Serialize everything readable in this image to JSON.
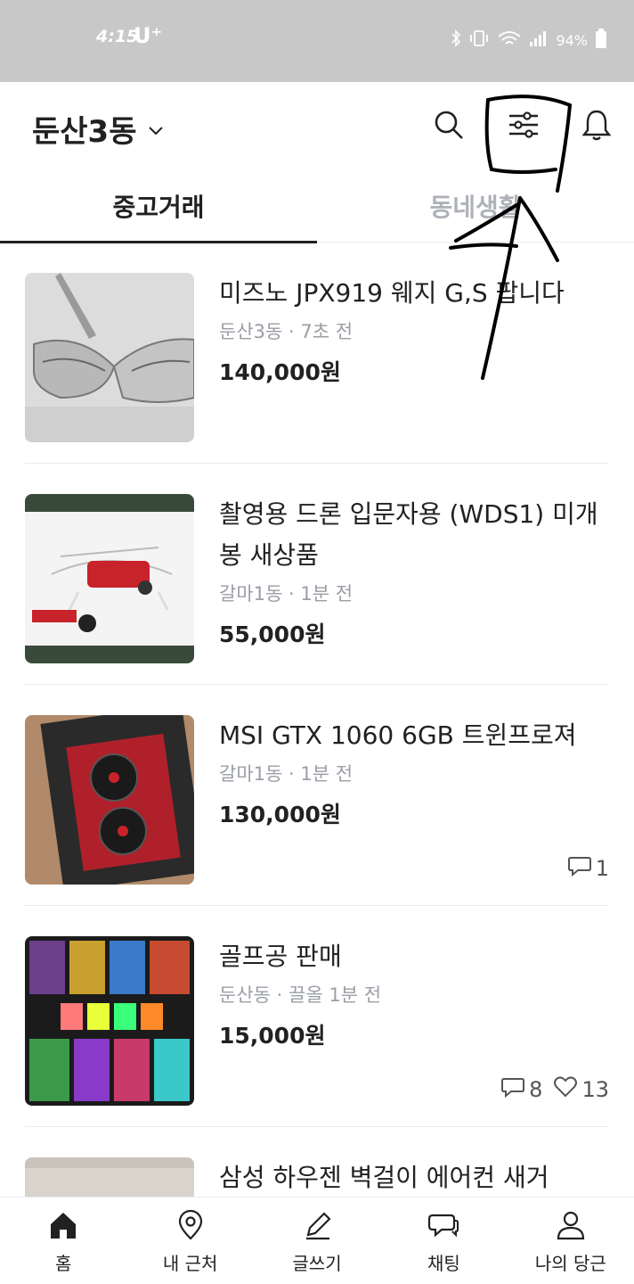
{
  "status_bar": {
    "time": "4:15",
    "carrier": "U⁺",
    "battery": "94%",
    "icons": [
      "bluetooth-icon",
      "vibrate-icon",
      "wifi-icon",
      "signal-icon",
      "battery-icon"
    ]
  },
  "header": {
    "location": "둔산3동",
    "icons": [
      "search-icon",
      "filter-icon",
      "bell-icon"
    ]
  },
  "tabs": [
    {
      "label": "중고거래",
      "active": true
    },
    {
      "label": "동네생활",
      "active": false
    }
  ],
  "items": [
    {
      "title": "미즈노 JPX919 웨지 G,S 팝니다",
      "location": "둔산3동",
      "time": "7초 전",
      "price": "140,000원",
      "chats": null,
      "likes": null
    },
    {
      "title": "촬영용 드론 입문자용 (WDS1) 미개봉 새상품",
      "location": "갈마1동",
      "time": "1분 전",
      "price": "55,000원",
      "chats": null,
      "likes": null
    },
    {
      "title": "MSI GTX 1060 6GB 트윈프로져",
      "location": "갈마1동",
      "time": "1분 전",
      "price": "130,000원",
      "chats": "1",
      "likes": null
    },
    {
      "title": "골프공 판매",
      "location": "둔산동",
      "time": "끌올 1분 전",
      "price": "15,000원",
      "chats": "8",
      "likes": "13"
    },
    {
      "title": "삼성 하우젠 벽걸이 에어컨 새거",
      "location": "",
      "time": "",
      "price": "",
      "chats": null,
      "likes": null
    }
  ],
  "meta_separator": "·",
  "bottom_nav": [
    {
      "label": "홈",
      "icon": "home-icon",
      "active": true
    },
    {
      "label": "내 근처",
      "icon": "location-pin-icon",
      "active": false
    },
    {
      "label": "글쓰기",
      "icon": "pencil-icon",
      "active": false
    },
    {
      "label": "채팅",
      "icon": "chat-icon",
      "active": false
    },
    {
      "label": "나의 당근",
      "icon": "person-icon",
      "active": false
    }
  ],
  "colors": {
    "text": "#212124",
    "muted": "#9a9ea5",
    "divider": "#eaebee",
    "status_bar": "#c8c8c8"
  }
}
